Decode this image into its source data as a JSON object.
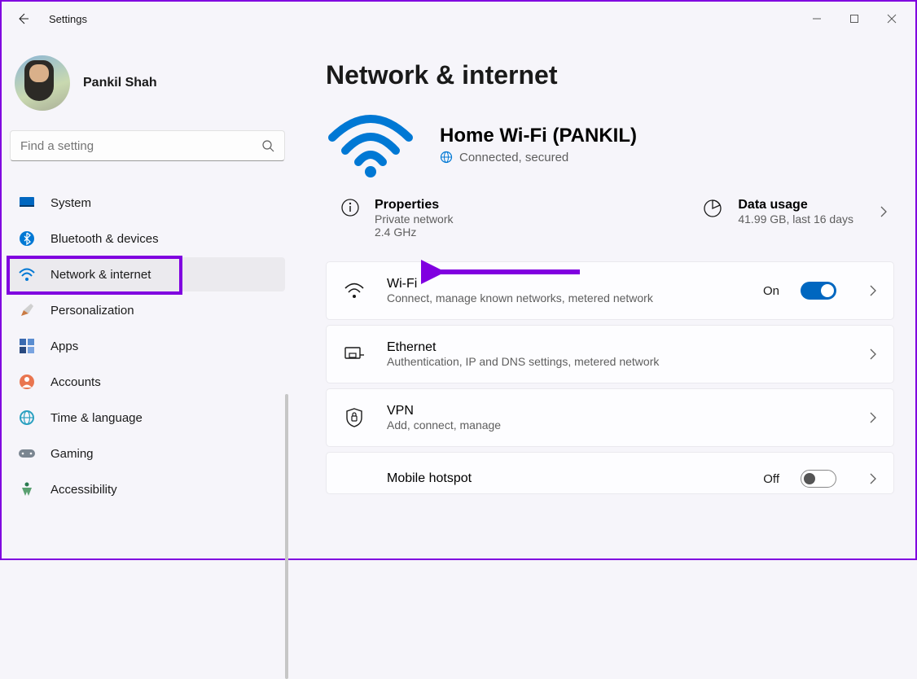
{
  "window": {
    "title": "Settings"
  },
  "user": {
    "name": "Pankil Shah"
  },
  "search": {
    "placeholder": "Find a setting"
  },
  "sidebar": {
    "items": [
      {
        "label": "System"
      },
      {
        "label": "Bluetooth & devices"
      },
      {
        "label": "Network & internet"
      },
      {
        "label": "Personalization"
      },
      {
        "label": "Apps"
      },
      {
        "label": "Accounts"
      },
      {
        "label": "Time & language"
      },
      {
        "label": "Gaming"
      },
      {
        "label": "Accessibility"
      }
    ],
    "selected_index": 2
  },
  "page": {
    "title": "Network & internet"
  },
  "network": {
    "ssid": "Home Wi-Fi (PANKIL)",
    "status": "Connected, secured"
  },
  "summary": {
    "properties": {
      "title": "Properties",
      "network_type": "Private network",
      "band": "2.4 GHz"
    },
    "data_usage": {
      "title": "Data usage",
      "details": "41.99 GB, last 16 days"
    }
  },
  "cards": {
    "wifi": {
      "title": "Wi-Fi",
      "sub": "Connect, manage known networks, metered network",
      "toggle_label": "On",
      "toggle_state": "on"
    },
    "ethernet": {
      "title": "Ethernet",
      "sub": "Authentication, IP and DNS settings, metered network"
    },
    "vpn": {
      "title": "VPN",
      "sub": "Add, connect, manage"
    },
    "hotspot": {
      "title": "Mobile hotspot",
      "toggle_label": "Off",
      "toggle_state": "off"
    }
  }
}
